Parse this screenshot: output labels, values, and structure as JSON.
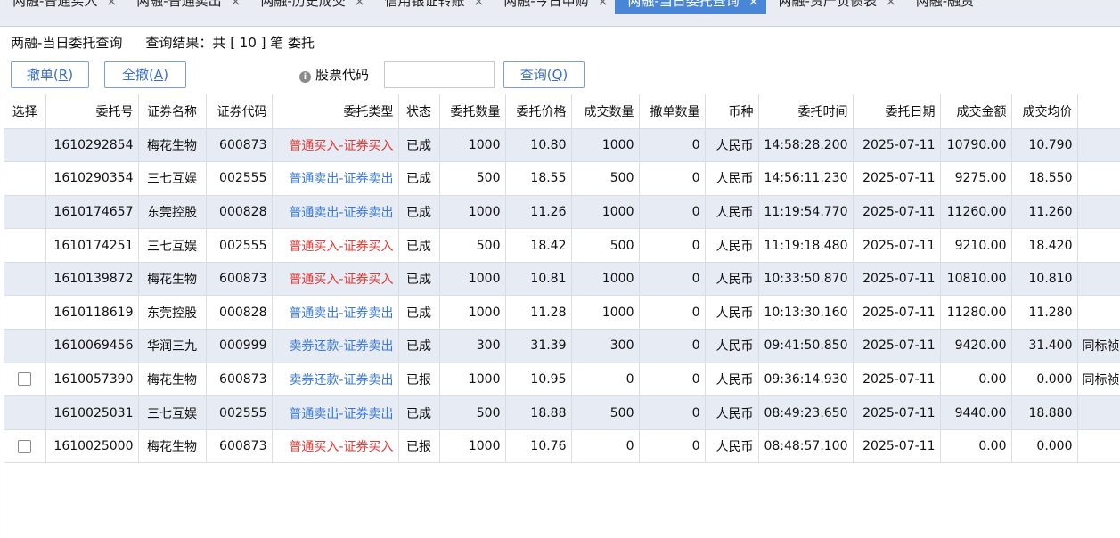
{
  "tabs": [
    {
      "label": "两融-普通买入",
      "active": false
    },
    {
      "label": "两融-普通卖出",
      "active": false
    },
    {
      "label": "两融-历史成交",
      "active": false
    },
    {
      "label": "信用银证转账",
      "active": false
    },
    {
      "label": "两融-今日申购",
      "active": false
    },
    {
      "label": "两融-当日委托查询",
      "active": true
    },
    {
      "label": "两融-资产负债表",
      "active": false
    },
    {
      "label": "两融-融资",
      "active": false
    }
  ],
  "tab_close_glyph": "×",
  "info": {
    "title": "两融-当日委托查询",
    "result": "查询结果：共 [ 10 ] 笔 委托"
  },
  "toolbar": {
    "cancel_label": "撤单(",
    "cancel_key": "R",
    "cancel_all_label": "全撤(",
    "cancel_all_key": "A",
    "stock_code_label": "股票代码",
    "stock_code_value": "",
    "query_label": "查询(",
    "query_key": "Q"
  },
  "table": {
    "headers": [
      "选择",
      "委托号",
      "证券名称",
      "证券代码",
      "委托类型",
      "状态",
      "委托数量",
      "委托价格",
      "成交数量",
      "撤单数量",
      "币种",
      "委托时间",
      "委托日期",
      "成交金额",
      "成交均价",
      ""
    ],
    "rows": [
      {
        "checkbox": false,
        "id": "1610292854",
        "name": "梅花生物",
        "code": "600873",
        "type": "普通买入-证券买入",
        "side": "buy",
        "status": "已成",
        "qty": "1000",
        "price": "10.80",
        "filled": "1000",
        "cancelled": "0",
        "currency": "人民币",
        "time": "14:58:28.200",
        "date": "2025-07-11",
        "amount": "10790.00",
        "avg": "10.790",
        "note": ""
      },
      {
        "checkbox": false,
        "id": "1610290354",
        "name": "三七互娱",
        "code": "002555",
        "type": "普通卖出-证券卖出",
        "side": "sell",
        "status": "已成",
        "qty": "500",
        "price": "18.55",
        "filled": "500",
        "cancelled": "0",
        "currency": "人民币",
        "time": "14:56:11.230",
        "date": "2025-07-11",
        "amount": "9275.00",
        "avg": "18.550",
        "note": ""
      },
      {
        "checkbox": false,
        "id": "1610174657",
        "name": "东莞控股",
        "code": "000828",
        "type": "普通卖出-证券卖出",
        "side": "sell",
        "status": "已成",
        "qty": "1000",
        "price": "11.26",
        "filled": "1000",
        "cancelled": "0",
        "currency": "人民币",
        "time": "11:19:54.770",
        "date": "2025-07-11",
        "amount": "11260.00",
        "avg": "11.260",
        "note": ""
      },
      {
        "checkbox": false,
        "id": "1610174251",
        "name": "三七互娱",
        "code": "002555",
        "type": "普通买入-证券买入",
        "side": "buy",
        "status": "已成",
        "qty": "500",
        "price": "18.42",
        "filled": "500",
        "cancelled": "0",
        "currency": "人民币",
        "time": "11:19:18.480",
        "date": "2025-07-11",
        "amount": "9210.00",
        "avg": "18.420",
        "note": ""
      },
      {
        "checkbox": false,
        "id": "1610139872",
        "name": "梅花生物",
        "code": "600873",
        "type": "普通买入-证券买入",
        "side": "buy",
        "status": "已成",
        "qty": "1000",
        "price": "10.81",
        "filled": "1000",
        "cancelled": "0",
        "currency": "人民币",
        "time": "10:33:50.870",
        "date": "2025-07-11",
        "amount": "10810.00",
        "avg": "10.810",
        "note": ""
      },
      {
        "checkbox": false,
        "id": "1610118619",
        "name": "东莞控股",
        "code": "000828",
        "type": "普通卖出-证券卖出",
        "side": "sell",
        "status": "已成",
        "qty": "1000",
        "price": "11.28",
        "filled": "1000",
        "cancelled": "0",
        "currency": "人民币",
        "time": "10:13:30.160",
        "date": "2025-07-11",
        "amount": "11280.00",
        "avg": "11.280",
        "note": ""
      },
      {
        "checkbox": false,
        "id": "1610069456",
        "name": "华润三九",
        "code": "000999",
        "type": "卖券还款-证券卖出",
        "side": "sell",
        "status": "已成",
        "qty": "300",
        "price": "31.39",
        "filled": "300",
        "cancelled": "0",
        "currency": "人民币",
        "time": "09:41:50.850",
        "date": "2025-07-11",
        "amount": "9420.00",
        "avg": "31.400",
        "note": "同标祯"
      },
      {
        "checkbox": true,
        "id": "1610057390",
        "name": "梅花生物",
        "code": "600873",
        "type": "卖券还款-证券卖出",
        "side": "sell",
        "status": "已报",
        "qty": "1000",
        "price": "10.95",
        "filled": "0",
        "cancelled": "0",
        "currency": "人民币",
        "time": "09:36:14.930",
        "date": "2025-07-11",
        "amount": "0.00",
        "avg": "0.000",
        "note": "同标祯"
      },
      {
        "checkbox": false,
        "id": "1610025031",
        "name": "三七互娱",
        "code": "002555",
        "type": "普通卖出-证券卖出",
        "side": "sell",
        "status": "已成",
        "qty": "500",
        "price": "18.88",
        "filled": "500",
        "cancelled": "0",
        "currency": "人民币",
        "time": "08:49:23.650",
        "date": "2025-07-11",
        "amount": "9440.00",
        "avg": "18.880",
        "note": ""
      },
      {
        "checkbox": true,
        "id": "1610025000",
        "name": "梅花生物",
        "code": "600873",
        "type": "普通买入-证券买入",
        "side": "buy",
        "status": "已报",
        "qty": "1000",
        "price": "10.76",
        "filled": "0",
        "cancelled": "0",
        "currency": "人民币",
        "time": "08:48:57.100",
        "date": "2025-07-11",
        "amount": "0.00",
        "avg": "0.000",
        "note": ""
      }
    ]
  },
  "colors": {
    "accent_tab": "#4a86d8",
    "buy": "#e53935",
    "sell": "#3a7ad6",
    "alt_row": "#e6ebf4",
    "button_text": "#3b6fc4"
  }
}
